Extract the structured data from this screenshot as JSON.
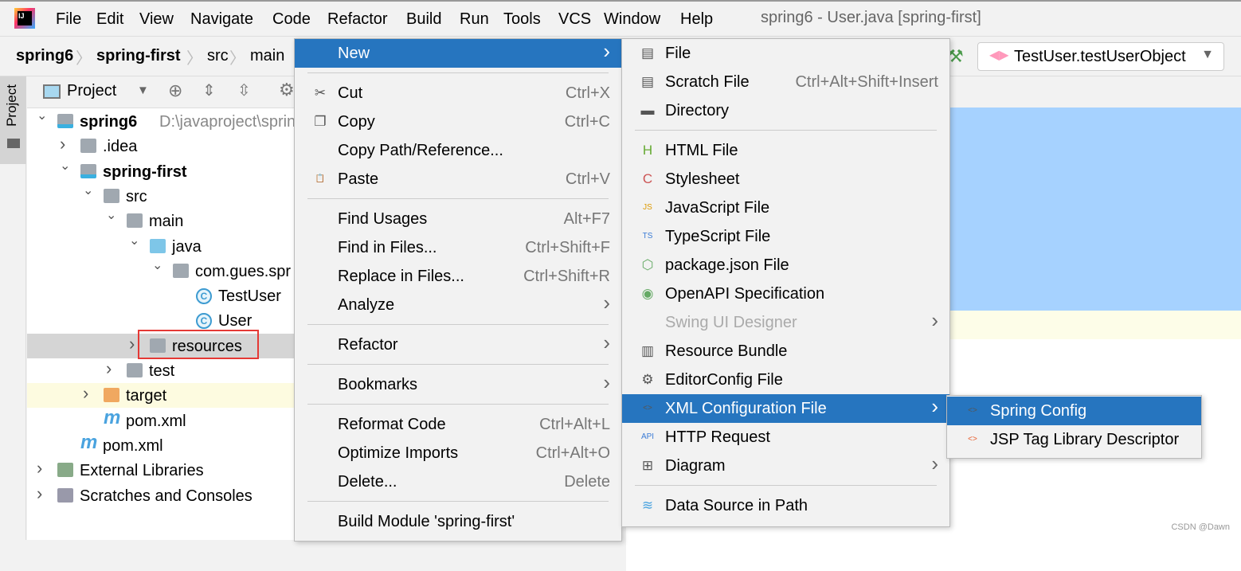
{
  "menubar": {
    "items": [
      "File",
      "Edit",
      "View",
      "Navigate",
      "Code",
      "Refactor",
      "Build",
      "Run",
      "Tools",
      "VCS",
      "Window",
      "Help"
    ],
    "window_title": "spring6 - User.java [spring-first]"
  },
  "breadcrumb": [
    "spring6",
    "spring-first",
    "src",
    "main"
  ],
  "run_config": "TestUser.testUserObject",
  "tool_window": {
    "tab": "Project",
    "title": "Project"
  },
  "tree": [
    {
      "label": "spring6",
      "extra": "D:\\javaproject\\sprin",
      "level": 0,
      "arrow": "down",
      "icon": "module",
      "bold": true
    },
    {
      "label": ".idea",
      "level": 1,
      "arrow": "right",
      "icon": "folder"
    },
    {
      "label": "spring-first",
      "level": 1,
      "arrow": "down",
      "icon": "module",
      "bold": true
    },
    {
      "label": "src",
      "level": 2,
      "arrow": "down",
      "icon": "folder"
    },
    {
      "label": "main",
      "level": 3,
      "arrow": "down",
      "icon": "folder"
    },
    {
      "label": "java",
      "level": 4,
      "arrow": "down",
      "icon": "source-folder"
    },
    {
      "label": "com.gues.spr",
      "level": 5,
      "arrow": "down",
      "icon": "package"
    },
    {
      "label": "TestUser",
      "level": 6,
      "icon": "class"
    },
    {
      "label": "User",
      "level": 6,
      "icon": "class"
    },
    {
      "label": "resources",
      "level": 4,
      "arrow": "right",
      "icon": "resources-folder",
      "selected": true
    },
    {
      "label": "test",
      "level": 3,
      "arrow": "right",
      "icon": "folder"
    },
    {
      "label": "target",
      "level": 2,
      "arrow": "right",
      "icon": "excluded-folder",
      "highlight": true
    },
    {
      "label": "pom.xml",
      "level": 2,
      "icon": "maven"
    },
    {
      "label": "pom.xml",
      "level": 1,
      "icon": "maven"
    },
    {
      "label": "External Libraries",
      "level": 0,
      "arrow": "right",
      "icon": "libraries"
    },
    {
      "label": "Scratches and Consoles",
      "level": 0,
      "arrow": "right",
      "icon": "scratches"
    }
  ],
  "context_menu": [
    {
      "label": "New",
      "submenu": true,
      "highlighted": true
    },
    {
      "sep": true
    },
    {
      "label": "Cut",
      "shortcut": "Ctrl+X",
      "icon": "scissors"
    },
    {
      "label": "Copy",
      "shortcut": "Ctrl+C",
      "icon": "copy"
    },
    {
      "label": "Copy Path/Reference..."
    },
    {
      "label": "Paste",
      "shortcut": "Ctrl+V",
      "icon": "clipboard"
    },
    {
      "sep": true
    },
    {
      "label": "Find Usages",
      "shortcut": "Alt+F7"
    },
    {
      "label": "Find in Files...",
      "shortcut": "Ctrl+Shift+F"
    },
    {
      "label": "Replace in Files...",
      "shortcut": "Ctrl+Shift+R"
    },
    {
      "label": "Analyze",
      "submenu": true
    },
    {
      "sep": true
    },
    {
      "label": "Refactor",
      "submenu": true
    },
    {
      "sep": true
    },
    {
      "label": "Bookmarks",
      "submenu": true
    },
    {
      "sep": true
    },
    {
      "label": "Reformat Code",
      "shortcut": "Ctrl+Alt+L"
    },
    {
      "label": "Optimize Imports",
      "shortcut": "Ctrl+Alt+O"
    },
    {
      "label": "Delete...",
      "shortcut": "Delete"
    },
    {
      "sep": true
    },
    {
      "label": "Build Module 'spring-first'"
    }
  ],
  "new_menu": [
    {
      "label": "File",
      "icon": "file"
    },
    {
      "label": "Scratch File",
      "shortcut": "Ctrl+Alt+Shift+Insert",
      "icon": "scratch"
    },
    {
      "label": "Directory",
      "icon": "folder"
    },
    {
      "sep": true
    },
    {
      "label": "HTML File",
      "icon": "html"
    },
    {
      "label": "Stylesheet",
      "icon": "css"
    },
    {
      "label": "JavaScript File",
      "icon": "js"
    },
    {
      "label": "TypeScript File",
      "icon": "ts"
    },
    {
      "label": "package.json File",
      "icon": "nodejs"
    },
    {
      "label": "OpenAPI Specification",
      "icon": "openapi"
    },
    {
      "label": "Swing UI Designer",
      "submenu": true,
      "disabled": true
    },
    {
      "label": "Resource Bundle",
      "icon": "resource-bundle"
    },
    {
      "label": "EditorConfig File",
      "icon": "gear"
    },
    {
      "label": "XML Configuration File",
      "submenu": true,
      "highlighted": true,
      "icon": "xml"
    },
    {
      "label": "HTTP Request",
      "icon": "api"
    },
    {
      "label": "Diagram",
      "submenu": true,
      "icon": "diagram"
    },
    {
      "sep": true
    },
    {
      "label": "Data Source in Path",
      "icon": "database"
    }
  ],
  "xml_menu": [
    {
      "label": "Spring Config",
      "highlighted": true,
      "icon": "spring-xml"
    },
    {
      "label": "JSP Tag Library Descriptor",
      "icon": "xml"
    }
  ],
  "colors": {
    "accent": "#2675bf",
    "selection": "#a6d2ff",
    "red_box": "#e53935"
  },
  "watermark": "CSDN @Dawn"
}
